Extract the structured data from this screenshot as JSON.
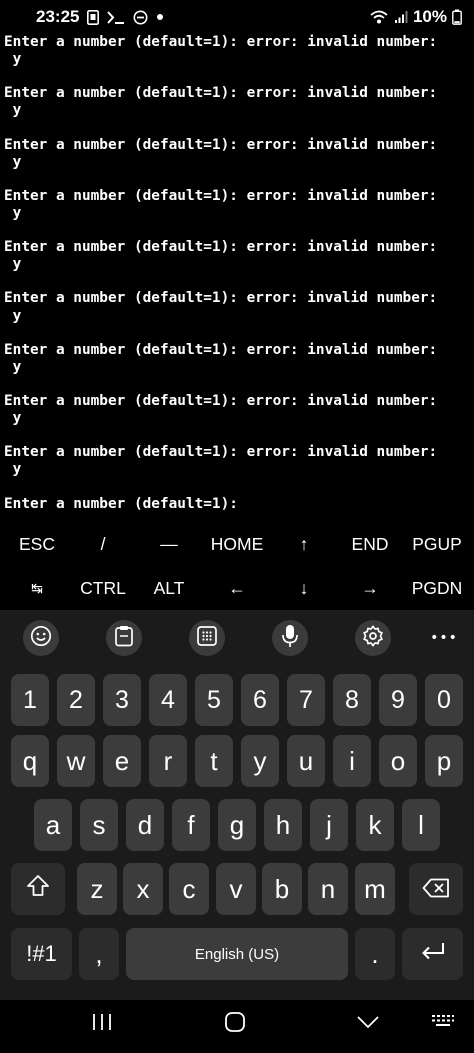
{
  "status_bar": {
    "time": "23:25",
    "battery": "10%",
    "icons": [
      "sim-icon",
      "terminal-icon",
      "do-not-disturb-icon",
      "dot-icon",
      "wifi-icon",
      "signal-icon",
      "battery-icon"
    ]
  },
  "terminal": {
    "lines": [
      "Enter a number (default=1): error: invalid number:",
      " y",
      "",
      "Enter a number (default=1): error: invalid number:",
      " y",
      "",
      "Enter a number (default=1): error: invalid number:",
      " y",
      "",
      "Enter a number (default=1): error: invalid number:",
      " y",
      "",
      "Enter a number (default=1): error: invalid number:",
      " y",
      "",
      "Enter a number (default=1): error: invalid number:",
      " y",
      "",
      "Enter a number (default=1): error: invalid number:",
      " y",
      "",
      "Enter a number (default=1): error: invalid number:",
      " y",
      "",
      "Enter a number (default=1): error: invalid number:",
      " y",
      "",
      "Enter a number (default=1):"
    ]
  },
  "extra_keys": {
    "row1": [
      "ESC",
      "/",
      "—",
      "HOME",
      "↑",
      "END",
      "PGUP"
    ],
    "row2": [
      "↹",
      "CTRL",
      "ALT",
      "←",
      "↓",
      "→",
      "PGDN"
    ]
  },
  "keyboard": {
    "toolbar": [
      "emoji-icon",
      "clipboard-icon",
      "keypad-icon",
      "microphone-icon",
      "settings-icon",
      "more-icon"
    ],
    "more_label": "•••",
    "row_numbers": [
      "1",
      "2",
      "3",
      "4",
      "5",
      "6",
      "7",
      "8",
      "9",
      "0"
    ],
    "row_top": [
      "q",
      "w",
      "e",
      "r",
      "t",
      "y",
      "u",
      "i",
      "o",
      "p"
    ],
    "row_middle": [
      "a",
      "s",
      "d",
      "f",
      "g",
      "h",
      "j",
      "k",
      "l"
    ],
    "row_bottom": [
      "z",
      "x",
      "c",
      "v",
      "b",
      "n",
      "m"
    ],
    "symbols_label": "!#1",
    "comma_label": ",",
    "space_label": "English (US)",
    "period_label": "."
  },
  "nav_bar": {
    "icons": [
      "recent-apps-icon",
      "home-icon",
      "back-icon",
      "keyboard-switch-icon"
    ]
  },
  "colors": {
    "background": "#000000",
    "keyboard_bg": "#1b1b1b",
    "key": "#3c3c3c",
    "key_dark": "#2c2c2c",
    "text": "#ffffff"
  }
}
